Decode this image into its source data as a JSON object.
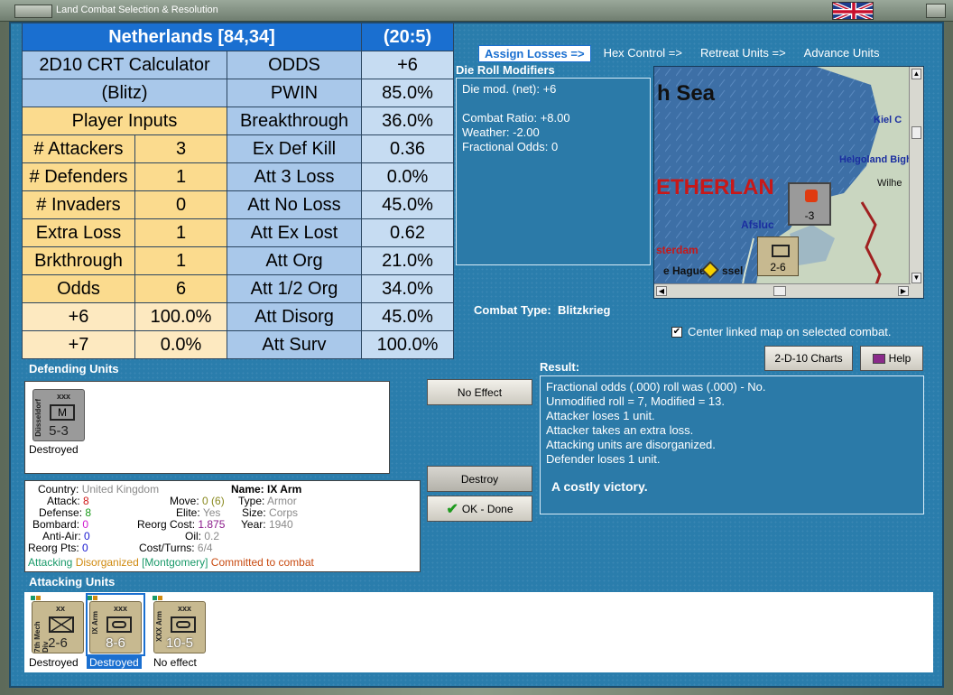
{
  "window": {
    "title": "Land Combat Selection & Resolution"
  },
  "crt": {
    "header_region": "Netherlands [84,34]",
    "header_ratio": "(20:5)",
    "calc_title_1": "2D10 CRT Calculator",
    "calc_title_2": "(Blitz)",
    "player_inputs": "Player Inputs",
    "inputs": [
      {
        "label": "# Attackers",
        "value": "3"
      },
      {
        "label": "# Defenders",
        "value": "1"
      },
      {
        "label": "# Invaders",
        "value": "0"
      },
      {
        "label": "Extra Loss",
        "value": "1"
      },
      {
        "label": "Brkthrough",
        "value": "1"
      },
      {
        "label": "Odds",
        "value": "6"
      }
    ],
    "odds_rows": [
      {
        "label": "+6",
        "value": "100.0%"
      },
      {
        "label": "+7",
        "value": "0.0%"
      }
    ],
    "results": [
      {
        "label": "ODDS",
        "value": "+6"
      },
      {
        "label": "PWIN",
        "value": "85.0%"
      },
      {
        "label": "Breakthrough",
        "value": "36.0%"
      },
      {
        "label": "Ex Def Kill",
        "value": "0.36"
      },
      {
        "label": "Att 3 Loss",
        "value": "0.0%"
      },
      {
        "label": "Att No Loss",
        "value": "45.0%"
      },
      {
        "label": "Att Ex Lost",
        "value": "0.62"
      },
      {
        "label": "Att Org",
        "value": "21.0%"
      },
      {
        "label": "Att 1/2 Org",
        "value": "34.0%"
      },
      {
        "label": "Att Disorg",
        "value": "45.0%"
      },
      {
        "label": "Att Surv",
        "value": "100.0%"
      }
    ]
  },
  "tabs": [
    "Assign Losses =>",
    "Hex Control =>",
    "Retreat Units =>",
    "Advance Units"
  ],
  "die_roll": {
    "heading": "Die Roll Modifiers",
    "lines": [
      "Die mod. (net): +6",
      "",
      "Combat Ratio: +8.00",
      "Weather: -2.00",
      "Fractional Odds: 0"
    ]
  },
  "map": {
    "sea_label": "h Sea",
    "country_label": "ETHERLAN",
    "places": [
      "Kiel C",
      "Helgoland Bigh",
      "Wilhe",
      "Afsluc",
      "sterdam",
      "e Hague",
      "ssel",
      "dam"
    ],
    "counters": [
      {
        "value": "2-6"
      },
      {
        "value": "-3"
      }
    ]
  },
  "combat_type": {
    "label": "Combat Type:",
    "value": "Blitzkrieg"
  },
  "center_map": {
    "label": "Center linked map on selected combat.",
    "checked": "✔"
  },
  "buttons": {
    "charts": "2-D-10 Charts",
    "help": "Help",
    "no_effect": "No Effect",
    "destroy": "Destroy",
    "ok_done": "OK - Done"
  },
  "result": {
    "heading": "Result:",
    "lines": [
      "Fractional odds (.000) roll was (.000)  - No.",
      "Unmodified roll = 7, Modified = 13.",
      "Attacker loses 1 unit.",
      "Attacker takes an extra loss.",
      "Attacking units are disorganized.",
      "Defender loses 1 unit."
    ],
    "summary": "A costly victory."
  },
  "defending": {
    "heading": "Defending Units",
    "units": [
      {
        "size": "xxx",
        "name": "Düsseldorf",
        "symbol": "M",
        "strength": "5-3",
        "status": "Destroyed"
      }
    ]
  },
  "unit_info": {
    "country_label": "Country:",
    "country": "United Kingdom",
    "attack_label": "Attack:",
    "attack": "8",
    "defense_label": "Defense:",
    "defense": "8",
    "bombard_label": "Bombard:",
    "bombard": "0",
    "antiair_label": "Anti-Air:",
    "antiair": "0",
    "reorg_label": "Reorg Pts:",
    "reorg": "0",
    "move_label": "Move:",
    "move": "0 (6)",
    "elite_label": "Elite:",
    "elite": "Yes",
    "reorgcost_label": "Reorg Cost:",
    "reorgcost": "1.875",
    "oil_label": "Oil:",
    "oil": "0.2",
    "costturns_label": "Cost/Turns:",
    "costturns": "6/4",
    "name_label": "Name:",
    "name": "IX Arm",
    "type_label": "Type:",
    "type": "Armor",
    "size_label": "Size:",
    "size": "Corps",
    "year_label": "Year:",
    "year": "1940",
    "status_1": "Attacking",
    "status_2": "Disorganized",
    "status_3": "[Montgomery]",
    "status_4": "Committed to combat"
  },
  "attacking": {
    "heading": "Attacking Units",
    "units": [
      {
        "size": "xx",
        "name": "7th Mech Div",
        "strength": "2-6",
        "status": "Destroyed"
      },
      {
        "size": "xxx",
        "name": "IX Arm",
        "strength": "8-6",
        "status": "Destroyed"
      },
      {
        "size": "xxx",
        "name": "XXX Arm",
        "strength": "10-5",
        "status": "No effect"
      }
    ]
  }
}
